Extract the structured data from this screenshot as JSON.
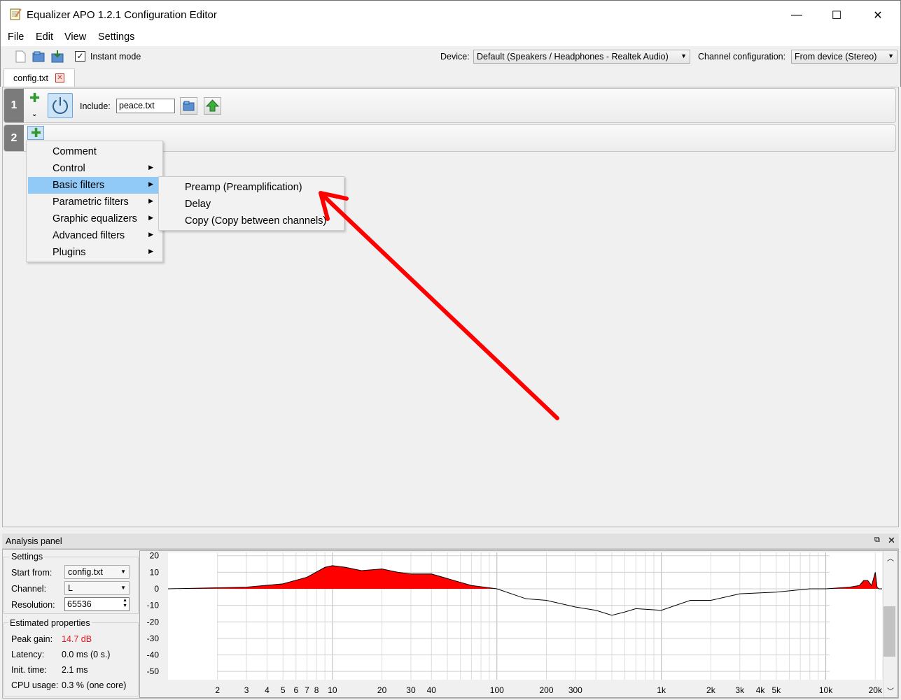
{
  "window": {
    "title": "Equalizer APO 1.2.1 Configuration Editor",
    "minimize": "—",
    "maximize": "☐",
    "close": "✕"
  },
  "menubar": [
    "File",
    "Edit",
    "View",
    "Settings"
  ],
  "toolbar": {
    "instant_mode_label": "Instant mode",
    "instant_mode_checked": true,
    "device_label": "Device:",
    "device_value": "Default (Speakers / Headphones - Realtek Audio)",
    "channel_config_label": "Channel configuration:",
    "channel_config_value": "From device (Stereo)"
  },
  "tab": {
    "label": "config.txt"
  },
  "rows": [
    {
      "number": "1",
      "include_label": "Include:",
      "include_value": "peace.txt"
    },
    {
      "number": "2"
    }
  ],
  "context_menu": {
    "items": [
      {
        "label": "Comment",
        "submenu": false
      },
      {
        "label": "Control",
        "submenu": true
      },
      {
        "label": "Basic filters",
        "submenu": true,
        "highlighted": true
      },
      {
        "label": "Parametric filters",
        "submenu": true
      },
      {
        "label": "Graphic equalizers",
        "submenu": true
      },
      {
        "label": "Advanced filters",
        "submenu": true
      },
      {
        "label": "Plugins",
        "submenu": true
      }
    ],
    "submenu_items": [
      "Preamp (Preamplification)",
      "Delay",
      "Copy (Copy between channels)"
    ]
  },
  "annotation_color": "#ff0000",
  "analysis": {
    "title": "Analysis panel",
    "settings_title": "Settings",
    "start_from_label": "Start from:",
    "start_from_value": "config.txt",
    "channel_label": "Channel:",
    "channel_value": "L",
    "resolution_label": "Resolution:",
    "resolution_value": "65536",
    "estimated_title": "Estimated properties",
    "peak_gain_label": "Peak gain:",
    "peak_gain_value": "14.7 dB",
    "peak_gain_color": "#e0141e",
    "latency_label": "Latency:",
    "latency_value": "0.0 ms (0 s.)",
    "init_time_label": "Init. time:",
    "init_time_value": "2.1 ms",
    "cpu_label": "CPU usage:",
    "cpu_value": "0.3 % (one core)"
  },
  "chart_data": {
    "type": "area",
    "xlabel": "",
    "ylabel": "",
    "x_scale": "log",
    "x_ticks": [
      "2",
      "3",
      "4",
      "5",
      "6",
      "7",
      "8",
      "10",
      "20",
      "30",
      "40",
      "100",
      "200",
      "300",
      "1k",
      "2k",
      "3k",
      "4k",
      "5k",
      "10k",
      "20k"
    ],
    "x_tick_values": [
      2,
      3,
      4,
      5,
      6,
      7,
      8,
      10,
      20,
      30,
      40,
      100,
      200,
      300,
      1000,
      2000,
      3000,
      4000,
      5000,
      10000,
      20000
    ],
    "y_ticks": [
      "20",
      "10",
      "0",
      "-10",
      "-20",
      "-30",
      "-40",
      "-50"
    ],
    "ylim": [
      -55,
      22
    ],
    "xlim": [
      1,
      22000
    ],
    "grid": true,
    "fill_color": "#ff0000",
    "series": [
      {
        "x": [
          1,
          3,
          5,
          7,
          9,
          10,
          12,
          15,
          20,
          25,
          30,
          40,
          55,
          70,
          100,
          150,
          200,
          300,
          400,
          500,
          600,
          700,
          1000,
          1500,
          2000,
          3000,
          5000,
          8000,
          10000,
          14000,
          16000,
          17000,
          18000,
          19000,
          20000,
          20500,
          21000,
          22000
        ],
        "y": [
          0,
          1,
          3,
          7,
          13,
          14,
          13,
          11,
          12,
          10,
          9,
          9,
          5,
          2,
          0,
          -6,
          -7,
          -11,
          -13,
          -16,
          -14,
          -12,
          -13,
          -7,
          -7,
          -3,
          -2,
          0,
          0,
          1,
          2,
          5,
          5,
          2,
          10,
          1,
          0,
          0
        ]
      }
    ]
  }
}
